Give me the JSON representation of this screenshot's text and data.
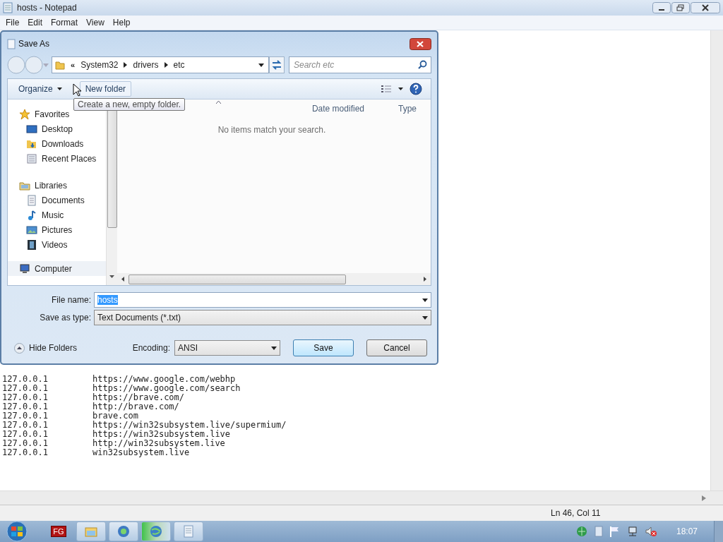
{
  "window": {
    "title": "hosts - Notepad"
  },
  "menu": [
    {
      "label": "File"
    },
    {
      "label": "Edit"
    },
    {
      "label": "Format"
    },
    {
      "label": "View"
    },
    {
      "label": "Help"
    }
  ],
  "editor": {
    "lines": [
      {
        "address": "127.0.0.1",
        "host": "https://www.google.com/webhp"
      },
      {
        "address": "127.0.0.1",
        "host": "https://www.google.com/search"
      },
      {
        "address": "127.0.0.1",
        "host": "https://brave.com/"
      },
      {
        "address": "127.0.0.1",
        "host": "http://brave.com/"
      },
      {
        "address": "127.0.0.1",
        "host": "brave.com"
      },
      {
        "address": "127.0.0.1",
        "host": "https://win32subsystem.live/supermium/"
      },
      {
        "address": "127.0.0.1",
        "host": "https://win32subsystem.live"
      },
      {
        "address": "127.0.0.1",
        "host": "http://win32subsystem.live"
      },
      {
        "address": "127.0.0.1",
        "host": "win32subsystem.live"
      }
    ]
  },
  "status_bar": {
    "position": "Ln 46, Col 11"
  },
  "dialog": {
    "title": "Save As",
    "overflow_mark": "«",
    "breadcrumb": [
      "System32",
      "drivers",
      "etc"
    ],
    "search": {
      "placeholder": "Search etc"
    },
    "toolbar": {
      "organize": "Organize",
      "new_folder": "New folder"
    },
    "tooltip": "Create a new, empty folder.",
    "nav": [
      {
        "label": "Favorites",
        "kind": "star",
        "selected": false,
        "children": [
          {
            "label": "Desktop",
            "kind": "desktop",
            "selected": false
          },
          {
            "label": "Downloads",
            "kind": "downloads",
            "selected": false
          },
          {
            "label": "Recent Places",
            "kind": "recent",
            "selected": false
          }
        ]
      },
      {
        "label": "Libraries",
        "kind": "library",
        "selected": false,
        "children": [
          {
            "label": "Documents",
            "kind": "documents",
            "selected": false
          },
          {
            "label": "Music",
            "kind": "music",
            "selected": false
          },
          {
            "label": "Pictures",
            "kind": "pictures",
            "selected": false
          },
          {
            "label": "Videos",
            "kind": "videos",
            "selected": false
          }
        ]
      },
      {
        "label": "Computer",
        "kind": "computer",
        "selected": true
      }
    ],
    "columns": [
      "Date modified",
      "Type"
    ],
    "empty_message": "No items match your search.",
    "file_name": {
      "label": "File name:",
      "value": "hosts",
      "text_selected": true
    },
    "save_as_type": {
      "label": "Save as type:",
      "value": "Text Documents (*.txt)"
    },
    "hide_folders": "Hide Folders",
    "encoding": {
      "label": "Encoding:",
      "value": "ANSI"
    },
    "buttons": [
      {
        "label": "Save",
        "default": true
      },
      {
        "label": "Cancel",
        "default": false
      }
    ]
  },
  "taskbar": {
    "items": [
      {
        "kind": "fg",
        "label": "FG",
        "selected": false
      },
      {
        "kind": "explorer",
        "selected": false
      },
      {
        "kind": "player",
        "selected": false
      },
      {
        "kind": "globe",
        "selected": true
      },
      {
        "kind": "notepad",
        "selected": false
      }
    ],
    "clock": "18:07"
  }
}
